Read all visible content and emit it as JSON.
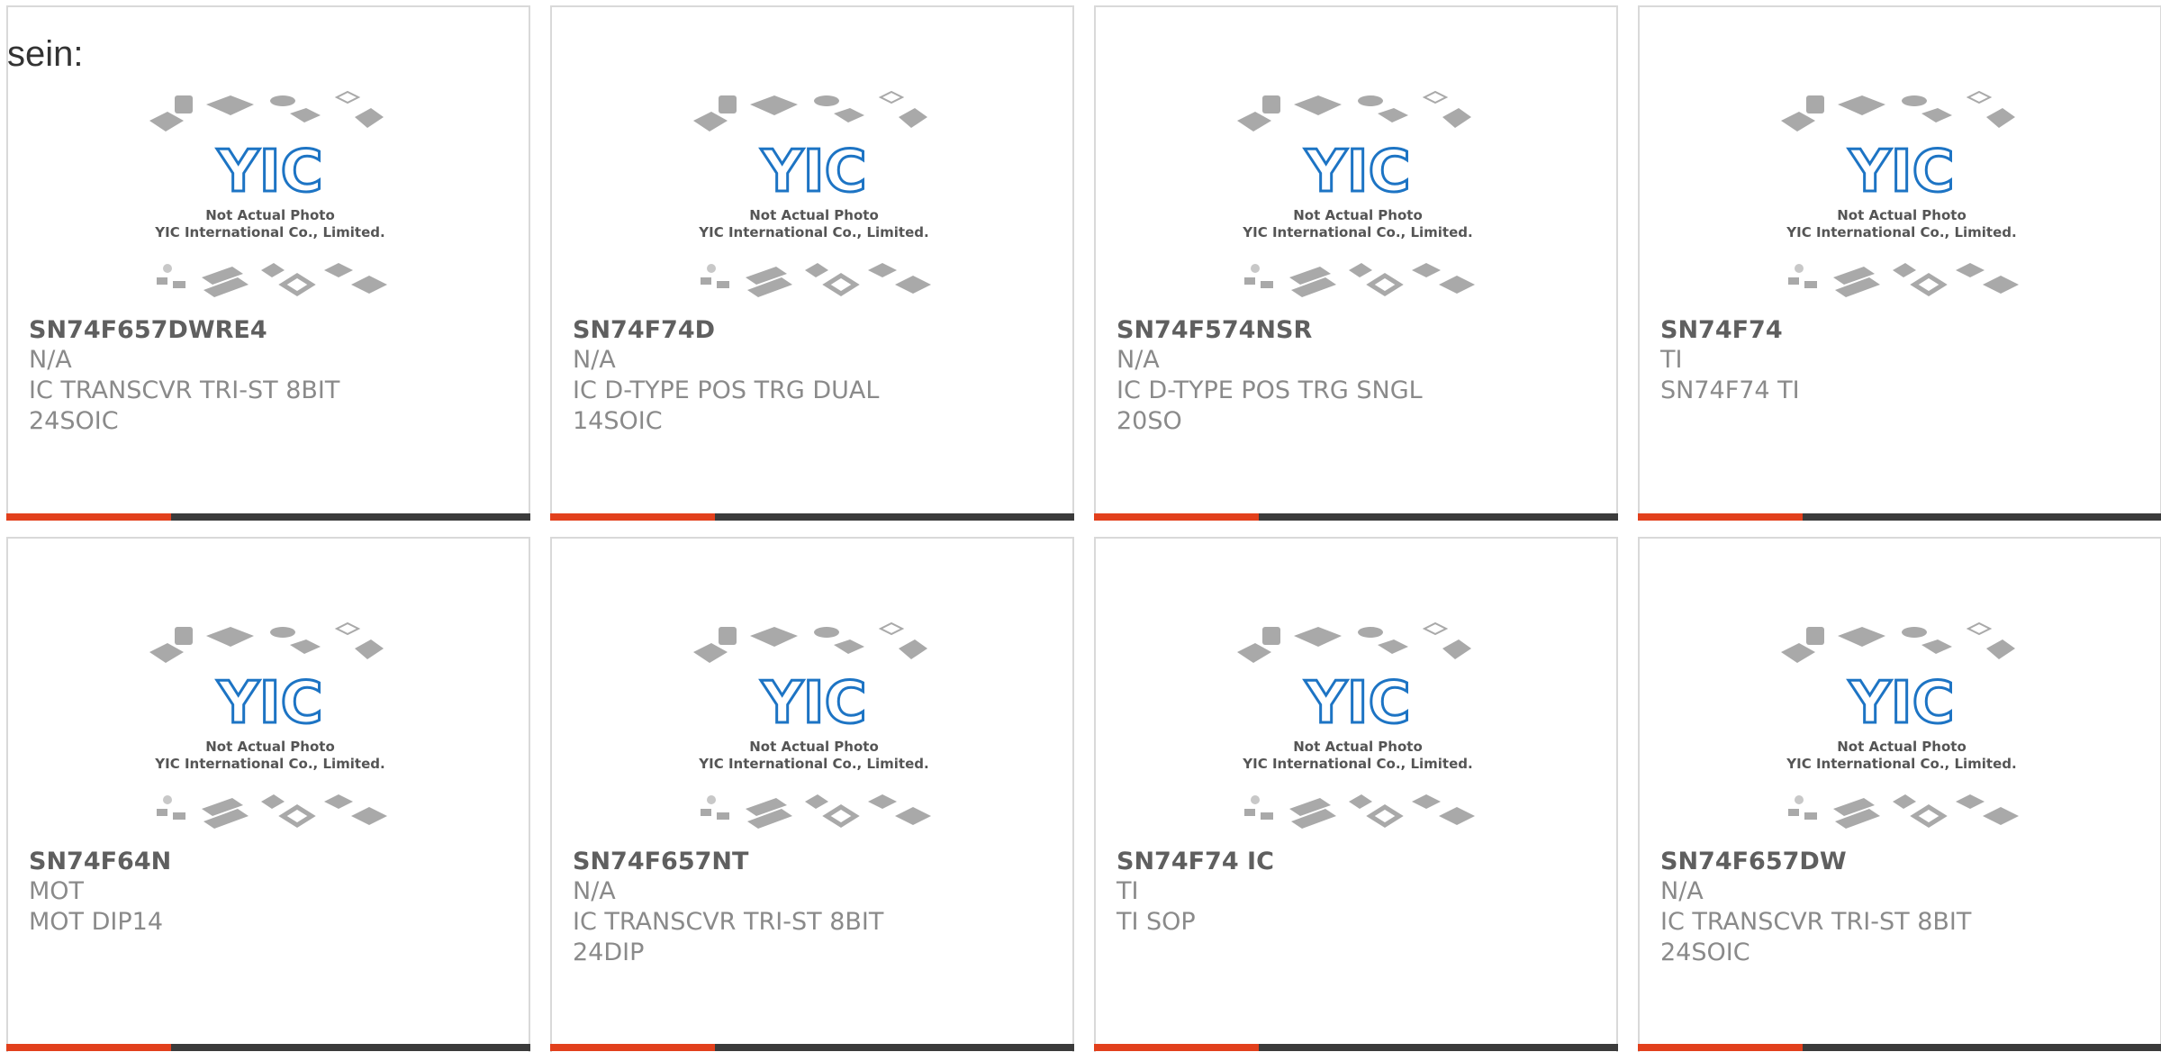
{
  "page": {
    "heading": "sein:"
  },
  "thumbnail": {
    "caption_line1": "Not Actual Photo",
    "caption_line2": "YIC International Co., Limited.",
    "logo_text": "YIC"
  },
  "colors": {
    "accent": "#e2401c",
    "bar": "#3b3b3b",
    "logo_blue": "#1d74c4",
    "chip_gray": "#a9a9a9"
  },
  "products": [
    {
      "part": "SN74F657DWRE4",
      "manufacturer": "N/A",
      "description_lines": [
        "IC TRANSCVR TRI-ST 8BIT",
        "24SOIC"
      ]
    },
    {
      "part": "SN74F74D",
      "manufacturer": "N/A",
      "description_lines": [
        "IC D-TYPE POS TRG DUAL",
        "14SOIC"
      ]
    },
    {
      "part": "SN74F574NSR",
      "manufacturer": "N/A",
      "description_lines": [
        "IC D-TYPE POS TRG SNGL 20SO"
      ]
    },
    {
      "part": "SN74F74",
      "manufacturer": "TI",
      "description_lines": [
        "SN74F74 TI"
      ]
    },
    {
      "part": "SN74F64N",
      "manufacturer": "MOT",
      "description_lines": [
        "MOT DIP14"
      ]
    },
    {
      "part": "SN74F657NT",
      "manufacturer": "N/A",
      "description_lines": [
        "IC TRANSCVR TRI-ST 8BIT 24DIP"
      ]
    },
    {
      "part": "SN74F74 IC",
      "manufacturer": "TI",
      "description_lines": [
        "TI SOP"
      ]
    },
    {
      "part": "SN74F657DW",
      "manufacturer": "N/A",
      "description_lines": [
        "IC TRANSCVR TRI-ST 8BIT",
        "24SOIC"
      ]
    }
  ]
}
